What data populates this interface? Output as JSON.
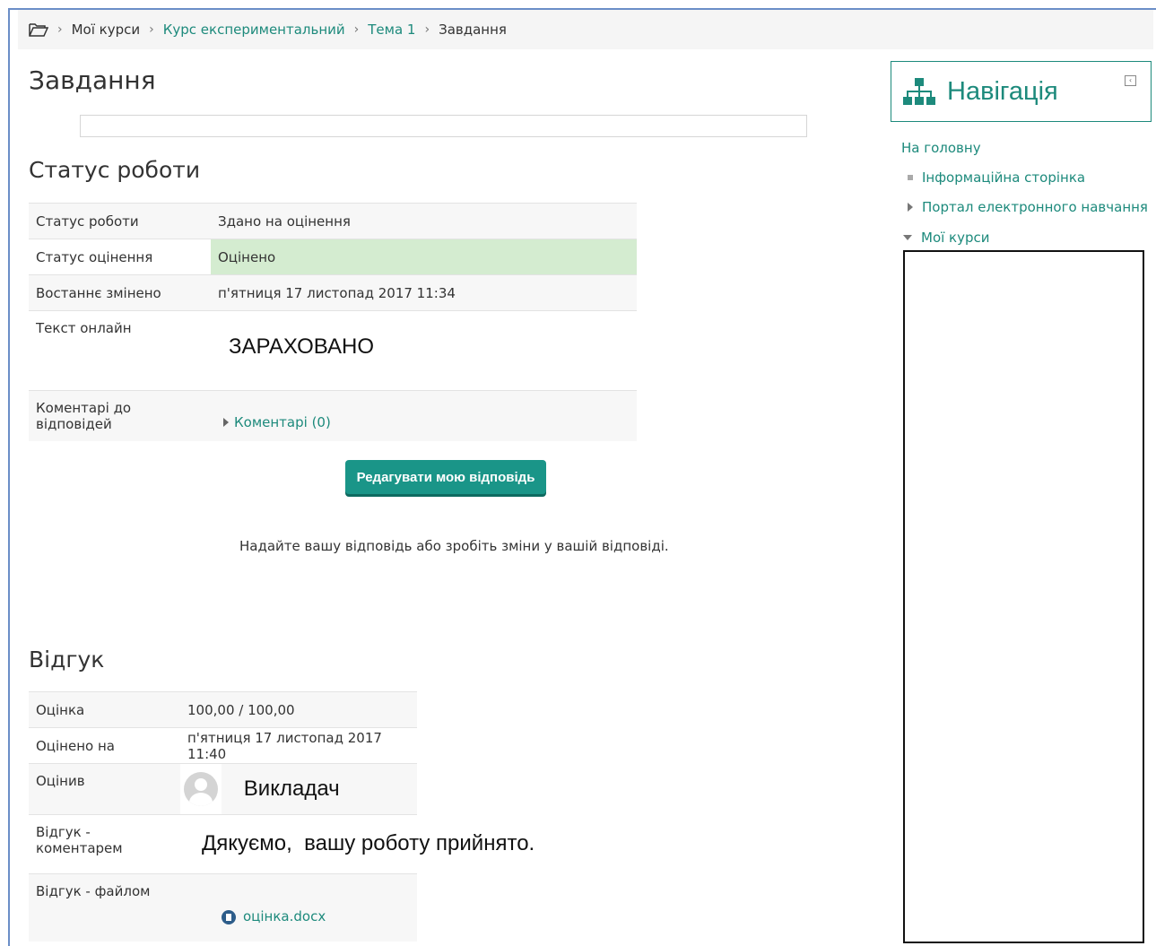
{
  "breadcrumb": {
    "items": [
      {
        "label": "Мої курси",
        "link": false
      },
      {
        "label": "Курс експериментальний",
        "link": true
      },
      {
        "label": "Тема 1",
        "link": true
      },
      {
        "label": "Завдання",
        "link": false
      }
    ],
    "separator": "›"
  },
  "page": {
    "title": "Завдання"
  },
  "submission": {
    "heading": "Статус роботи",
    "rows": [
      {
        "label": "Статус роботи",
        "value": "Здано на оцінення"
      },
      {
        "label": "Статус оцінення",
        "value": "Оцінено"
      },
      {
        "label": "Востаннє змінено",
        "value": "п'ятниця 17 листопад 2017 11:34"
      },
      {
        "label": "Текст онлайн",
        "value": "ЗАРАХОВАНО"
      },
      {
        "label": "Коментарі до відповідей",
        "value": "Коментарі (0)"
      }
    ],
    "edit_button": "Редагувати мою відповідь",
    "hint": "Надайте вашу відповідь або зробіть зміни у вашій відповіді."
  },
  "feedback": {
    "heading": "Відгук",
    "rows": [
      {
        "label": "Оцінка",
        "value": "100,00 / 100,00"
      },
      {
        "label": "Оцінено на",
        "value": "п'ятниця 17 листопад 2017 11:40"
      },
      {
        "label": "Оцінив",
        "value": "Викладач"
      },
      {
        "label": "Відгук - коментарем",
        "value": "Дякуємо,  вашу роботу прийнято."
      },
      {
        "label": "Відгук - файлом",
        "value": "оцінка.docx"
      }
    ]
  },
  "navigation": {
    "title": "Навігація",
    "home": "На головну",
    "items": [
      {
        "label": "Інформаційна сторінка",
        "marker": "bullet"
      },
      {
        "label": "Портал електронного навчання",
        "marker": "collapsed"
      },
      {
        "label": "Мої курси",
        "marker": "expanded"
      }
    ]
  },
  "colors": {
    "accent": "#1d8a7c",
    "button": "#1a9588",
    "graded_bg": "#d4ecd0"
  }
}
